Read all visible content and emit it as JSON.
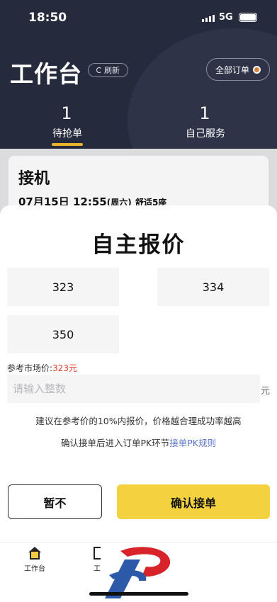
{
  "status_bar": {
    "time": "18:50",
    "network": "5G"
  },
  "header": {
    "title": "工作台",
    "refresh_label": "刷新",
    "all_orders_label": "全部订单"
  },
  "tabs": [
    {
      "count": "1",
      "label": "待抢单"
    },
    {
      "count": "1",
      "label": "自己服务"
    }
  ],
  "order_card": {
    "title": "接机",
    "datetime": "07月15日 12:55",
    "weekday": "(周六)",
    "car_type": "舒适5座"
  },
  "quote_sheet": {
    "title": "自主报价",
    "options": [
      "323",
      "334",
      "350"
    ],
    "reference_label": "参考市场价:",
    "reference_value": "323元",
    "input_placeholder": "请输入整数",
    "unit": "元",
    "hint_1": "建议在参考价的10%内报价，价格越合理成功率越高",
    "hint_2_prefix": "确认接单后进入订单PK环节",
    "hint_2_link": "接单PK规则",
    "decline_label": "暂不",
    "confirm_label": "确认接单"
  },
  "bottom_nav": {
    "items": [
      {
        "label": "工作台",
        "icon": "home-icon"
      },
      {
        "label": "工",
        "icon": "bracket-icon"
      }
    ]
  },
  "colors": {
    "header_bg": "#252a3c",
    "accent_yellow": "#f4d13e",
    "tab_underline": "#e9b42c",
    "price_red": "#e23c2b",
    "link_blue": "#5b74c9"
  }
}
